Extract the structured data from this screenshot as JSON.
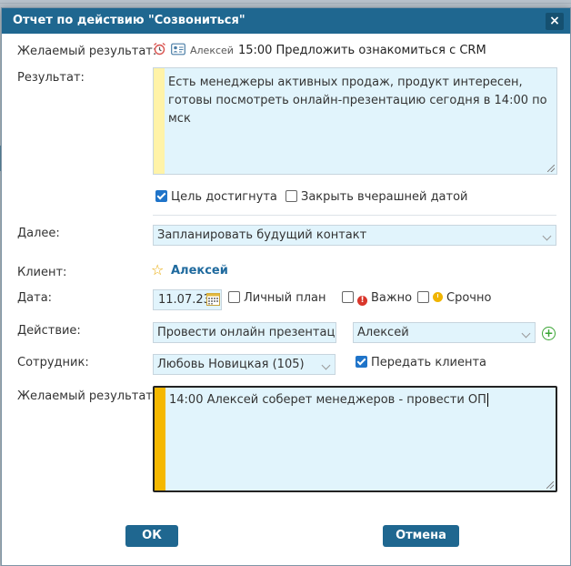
{
  "dialog": {
    "title": "Отчет по действию \"Созвониться\"",
    "close_glyph": "×"
  },
  "desired": {
    "label": "Желаемый результат:",
    "person": "Алексей",
    "text": "15:00 Предложить ознакомиться с CRM",
    "icons": [
      "alarm-clock-icon",
      "contact-card-icon"
    ]
  },
  "result": {
    "label": "Результат:",
    "text": "Есть менеджеры активных продаж, продукт интересен, готовы посмотреть онлайн-презентацию сегодня в 14:00 по мск",
    "stripe_color": "#fff3a8"
  },
  "options": {
    "goal_reached": "Цель достигнута",
    "goal_reached_checked": true,
    "close_yesterday": "Закрыть вчерашней датой",
    "close_yesterday_checked": false
  },
  "next": {
    "label": "Далее:",
    "value": "Запланировать будущий контакт"
  },
  "client": {
    "label": "Клиент:",
    "name": "Алексей"
  },
  "date": {
    "label": "Дата:",
    "value": "11.07.23",
    "personal_plan": "Личный план",
    "important": "Важно",
    "urgent": "Срочно"
  },
  "action": {
    "label": "Действие:",
    "value": "Провести онлайн презентаци",
    "contact": "Алексей"
  },
  "employee": {
    "label": "Сотрудник:",
    "value": "Любовь Новицкая (105)",
    "transfer": "Передать клиента",
    "transfer_checked": true
  },
  "next_desired": {
    "label": "Желаемый результат:",
    "text": "14:00 Алексей соберет менеджеров - провести ОП",
    "stripe_color": "#f5b800"
  },
  "buttons": {
    "ok": "ОК",
    "cancel": "Отмена"
  },
  "colors": {
    "titlebar": "#1f6790",
    "field_bg": "#e1f4fc",
    "link": "#1f6a9e"
  }
}
